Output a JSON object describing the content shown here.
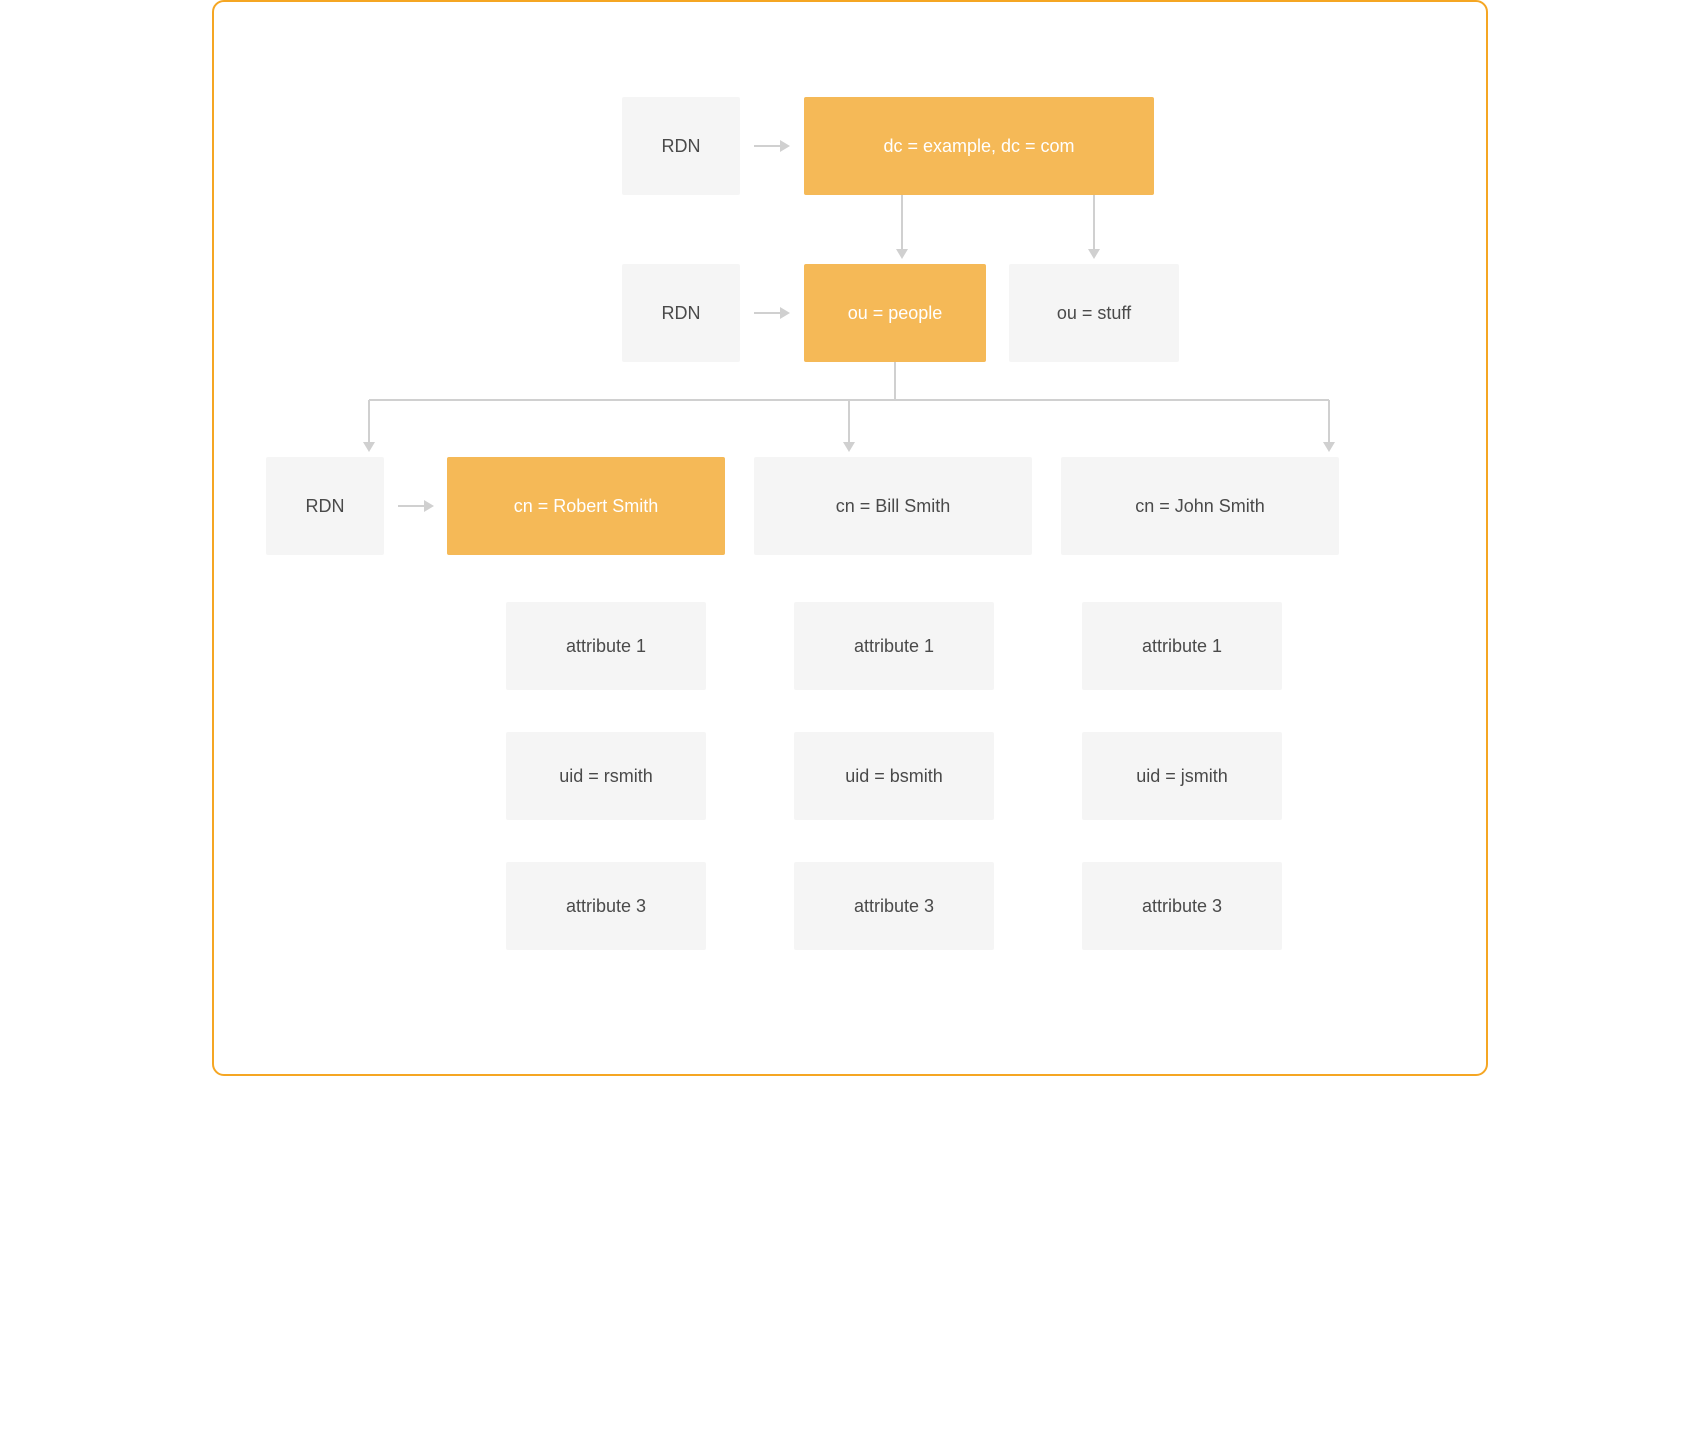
{
  "rdn_label": "RDN",
  "level1": {
    "root": "dc = example, dc = com"
  },
  "level2": {
    "ou_people": "ou = people",
    "ou_stuff": "ou = stuff"
  },
  "level3": {
    "entries": [
      {
        "cn": "cn = Robert Smith",
        "attrs": [
          "attribute 1",
          "uid = rsmith",
          "attribute 3"
        ],
        "highlighted": true
      },
      {
        "cn": "cn = Bill Smith",
        "attrs": [
          "attribute 1",
          "uid = bsmith",
          "attribute 3"
        ],
        "highlighted": false
      },
      {
        "cn": "cn = John Smith",
        "attrs": [
          "attribute 1",
          "uid = jsmith",
          "attribute 3"
        ],
        "highlighted": false
      }
    ]
  },
  "colors": {
    "accent": "#f5b957",
    "box": "#f5f5f5",
    "text": "#4a4a4a",
    "arrow": "#d0d0d0",
    "border": "#f5a623"
  }
}
